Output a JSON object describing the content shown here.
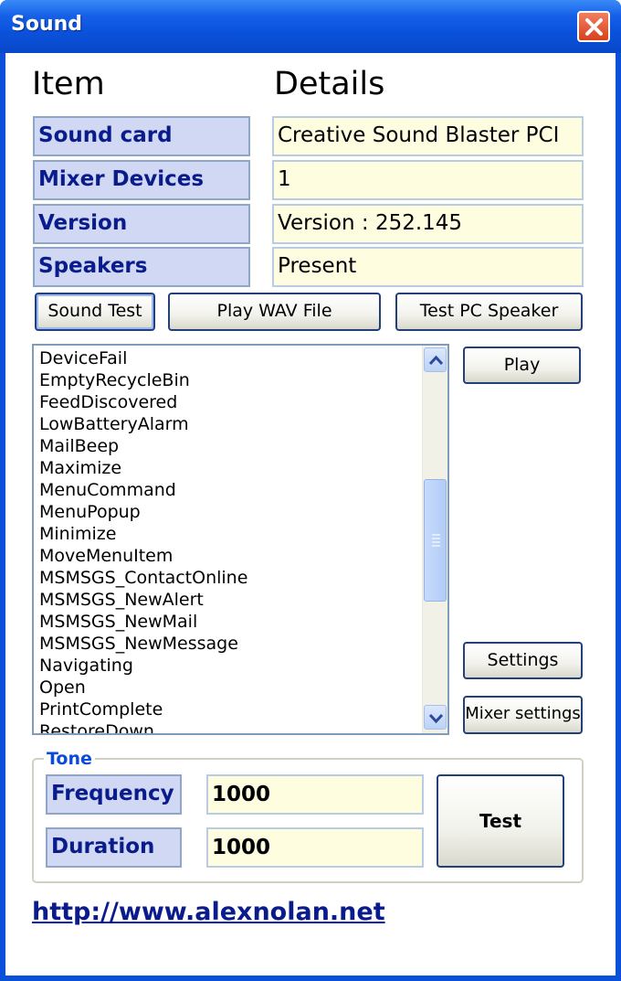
{
  "window": {
    "title": "Sound"
  },
  "headers": {
    "item": "Item",
    "details": "Details"
  },
  "info_rows": [
    {
      "item": "Sound card",
      "detail": "Creative Sound Blaster PCI"
    },
    {
      "item": "Mixer Devices",
      "detail": "1"
    },
    {
      "item": "Version",
      "detail": "Version : 252.145"
    },
    {
      "item": "Speakers",
      "detail": "Present"
    }
  ],
  "buttons": {
    "sound_test": "Sound Test",
    "play_wav": "Play WAV File",
    "test_pc_speaker": "Test PC Speaker",
    "play": "Play",
    "settings": "Settings",
    "mixer_settings": "Mixer settings",
    "test": "Test"
  },
  "sound_list": [
    "DeviceFail",
    "EmptyRecycleBin",
    "FeedDiscovered",
    "LowBatteryAlarm",
    "MailBeep",
    "Maximize",
    "MenuCommand",
    "MenuPopup",
    "Minimize",
    "MoveMenuItem",
    "MSMSGS_ContactOnline",
    "MSMSGS_NewAlert",
    "MSMSGS_NewMail",
    "MSMSGS_NewMessage",
    "Navigating",
    "Open",
    "PrintComplete",
    "RestoreDown"
  ],
  "tone": {
    "group_label": "Tone",
    "frequency_label": "Frequency",
    "frequency_value": "1000",
    "duration_label": "Duration",
    "duration_value": "1000"
  },
  "link": "http://www.alexnolan.net",
  "colors": {
    "titlebar": "#0a52dc",
    "item_bg": "#d0d8f4",
    "detail_bg": "#fefde0",
    "accent": "#0a1c8c"
  }
}
